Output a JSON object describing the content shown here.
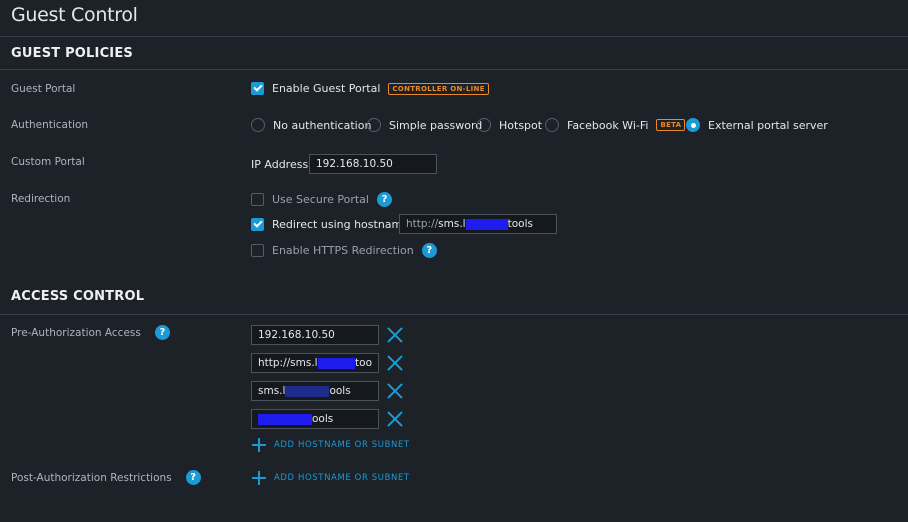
{
  "page": {
    "title": "Guest Control"
  },
  "guest_policies": {
    "title": "GUEST POLICIES",
    "guest_portal": {
      "label": "Guest Portal",
      "enable_label": "Enable Guest Portal",
      "enabled": true,
      "badge": "CONTROLLER ON-LINE",
      "badge_color": "#e8892a"
    },
    "authentication": {
      "label": "Authentication",
      "options": [
        {
          "label": "No authentication",
          "selected": false
        },
        {
          "label": "Simple password",
          "selected": false
        },
        {
          "label": "Hotspot",
          "selected": false
        },
        {
          "label": "Facebook Wi-Fi",
          "selected": false,
          "badge": "BETA"
        },
        {
          "label": "External portal server",
          "selected": true
        }
      ]
    },
    "custom_portal": {
      "label": "Custom Portal",
      "ip_label": "IP Address",
      "ip_value": "192.168.10.50"
    },
    "redirection": {
      "label": "Redirection",
      "use_secure_portal": {
        "label": "Use Secure Portal",
        "checked": false
      },
      "redirect_hostname": {
        "label": "Redirect using hostname",
        "checked": true,
        "prefix": "http://",
        "value_start": "sms.l",
        "value_end": "tools"
      },
      "https_redirection": {
        "label": "Enable HTTPS Redirection",
        "checked": false
      }
    }
  },
  "access_control": {
    "title": "ACCESS CONTROL",
    "pre_auth": {
      "label": "Pre-Authorization Access",
      "entries": [
        {
          "start": "192.168.10.50",
          "end": ""
        },
        {
          "start": "http://sms.l",
          "end": "too"
        },
        {
          "start": "sms.l",
          "end": "ools"
        },
        {
          "start": "",
          "end": "ools"
        }
      ],
      "add_label": "ADD HOSTNAME OR SUBNET"
    },
    "post_auth": {
      "label": "Post-Authorization Restrictions",
      "add_label": "ADD HOSTNAME OR SUBNET"
    }
  },
  "colors": {
    "accent": "#1b9ad6",
    "background": "#1d2128",
    "redaction": "#1f1cf0"
  },
  "icons": {
    "help": "question-circle-icon",
    "remove": "close-x-icon",
    "add": "plus-icon"
  }
}
